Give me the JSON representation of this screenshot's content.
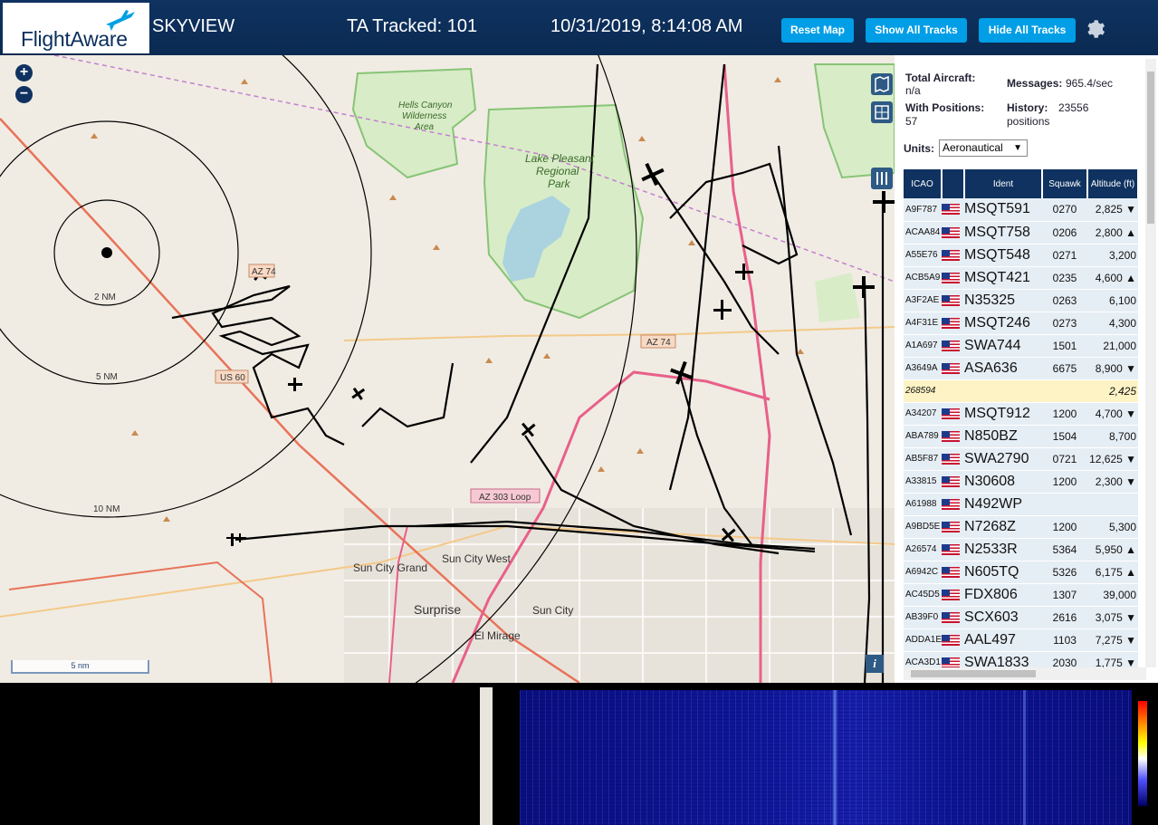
{
  "header": {
    "logo": "FlightAware",
    "app_title": "SKYVIEW",
    "tracked": "TA Tracked: 101",
    "datetime": "10/31/2019, 8:14:08 AM",
    "buttons": {
      "reset_map": "Reset Map",
      "show_all": "Show All Tracks",
      "hide_all": "Hide All Tracks"
    },
    "settings_icon": "gear-icon"
  },
  "map": {
    "zoom_in": "+",
    "zoom_out": "−",
    "scale_label": "5 nm",
    "info_label": "i",
    "ring_labels": [
      "2 NM",
      "5 NM",
      "10 NM"
    ],
    "places": [
      "Hells Canyon Wilderness Area",
      "Lake Pleasant Regional Park",
      "Sun City Grand",
      "Sun City West",
      "Surprise",
      "Sun City",
      "El Mirage"
    ],
    "road_labels": [
      "AZ 74",
      "AZ 74",
      "US 60",
      "AZ 303 Loop"
    ],
    "colors": {
      "land": "#f0ece3",
      "water": "#aad3df",
      "park": "#c8e6b5",
      "highway": "#e8608a",
      "track": "#000000"
    }
  },
  "panel": {
    "total_aircraft_label": "Total Aircraft:",
    "total_aircraft_value": "n/a",
    "with_positions_label": "With Positions:",
    "with_positions_value": "57",
    "messages_label": "Messages:",
    "messages_value": "965.4/sec",
    "history_label": "History:",
    "history_value": "23556 positions",
    "units_label": "Units:",
    "units_value": "Aeronautical",
    "columns": [
      "ICAO",
      "",
      "Ident",
      "Squawk",
      "Altitude (ft)"
    ],
    "rows": [
      {
        "icao": "A9F787",
        "ident": "MSQT591",
        "squawk": "0270",
        "alt": "2,825 ▼"
      },
      {
        "icao": "ACAA84",
        "ident": "MSQT758",
        "squawk": "0206",
        "alt": "2,800 ▲"
      },
      {
        "icao": "A55E76",
        "ident": "MSQT548",
        "squawk": "0271",
        "alt": "3,200"
      },
      {
        "icao": "ACB5A9",
        "ident": "MSQT421",
        "squawk": "0235",
        "alt": "4,600 ▲"
      },
      {
        "icao": "A3F2AE",
        "ident": "N35325",
        "squawk": "0263",
        "alt": "6,100"
      },
      {
        "icao": "A4F31E",
        "ident": "MSQT246",
        "squawk": "0273",
        "alt": "4,300"
      },
      {
        "icao": "A1A697",
        "ident": "SWA744",
        "squawk": "1501",
        "alt": "21,000"
      },
      {
        "icao": "A3649A",
        "ident": "ASA636",
        "squawk": "6675",
        "alt": "8,900 ▼"
      },
      {
        "icao": "268594",
        "ident": "",
        "squawk": "",
        "alt": "2,425",
        "selected": true
      },
      {
        "icao": "A34207",
        "ident": "MSQT912",
        "squawk": "1200",
        "alt": "4,700 ▼"
      },
      {
        "icao": "ABA789",
        "ident": "N850BZ",
        "squawk": "1504",
        "alt": "8,700"
      },
      {
        "icao": "AB5F87",
        "ident": "SWA2790",
        "squawk": "0721",
        "alt": "12,625 ▼"
      },
      {
        "icao": "A33815",
        "ident": "N30608",
        "squawk": "1200",
        "alt": "2,300 ▼"
      },
      {
        "icao": "A61988",
        "ident": "N492WP",
        "squawk": "",
        "alt": ""
      },
      {
        "icao": "A9BD5E",
        "ident": "N7268Z",
        "squawk": "1200",
        "alt": "5,300"
      },
      {
        "icao": "A26574",
        "ident": "N2533R",
        "squawk": "5364",
        "alt": "5,950 ▲"
      },
      {
        "icao": "A6942C",
        "ident": "N605TQ",
        "squawk": "5326",
        "alt": "6,175 ▲"
      },
      {
        "icao": "AC45D5",
        "ident": "FDX806",
        "squawk": "1307",
        "alt": "39,000"
      },
      {
        "icao": "AB39F0",
        "ident": "SCX603",
        "squawk": "2616",
        "alt": "3,075 ▼"
      },
      {
        "icao": "ADDA1E",
        "ident": "AAL497",
        "squawk": "1103",
        "alt": "7,275 ▼"
      },
      {
        "icao": "ACA3D1",
        "ident": "SWA1833",
        "squawk": "2030",
        "alt": "1,775 ▼"
      }
    ]
  }
}
